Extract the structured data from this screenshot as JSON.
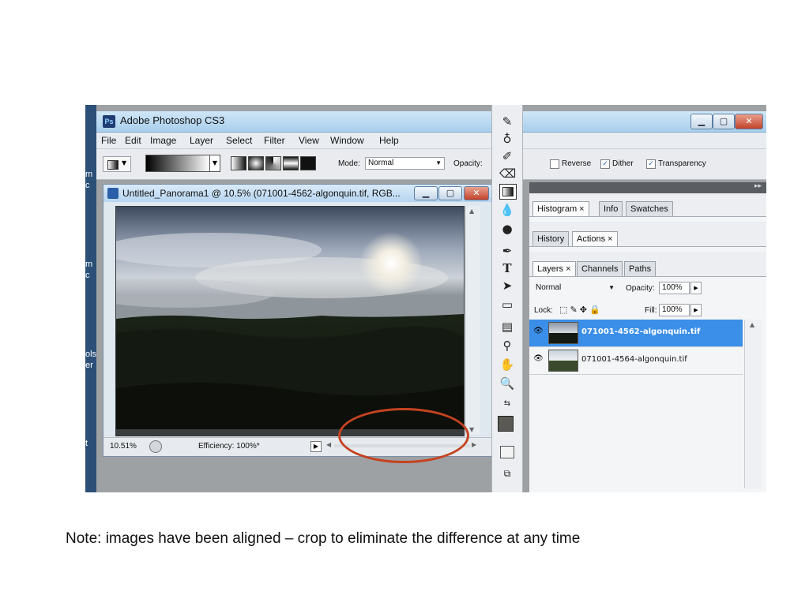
{
  "app": {
    "title": "Adobe Photoshop CS3",
    "logo": "Ps",
    "window_buttons": {
      "minimize": "▁",
      "maximize": "▢",
      "close": "✕"
    }
  },
  "desktop_strip_text": [
    "m",
    "c",
    "m",
    "c",
    "ols",
    "er",
    "t"
  ],
  "menu": [
    "File",
    "Edit",
    "Image",
    "Layer",
    "Select",
    "Filter",
    "View",
    "Window",
    "Help"
  ],
  "options_bar": {
    "mode_label": "Mode:",
    "mode_value": "Normal",
    "opacity_label": "Opacity:",
    "reverse_label": "Reverse",
    "reverse_checked": false,
    "dither_label": "Dither",
    "dither_checked": true,
    "transparency_label": "Transparency",
    "transparency_checked": true
  },
  "document": {
    "title": "Untitled_Panorama1 @ 10.5% (071001-4562-algonquin.tif, RGB...",
    "zoom": "10.51%",
    "efficiency": "Efficiency: 100%*"
  },
  "panels": {
    "group1_tabs": [
      "Histogram ×",
      "Info",
      "Swatches"
    ],
    "group2_tabs": [
      "History",
      "Actions ×"
    ],
    "group3_tabs": [
      "Layers ×",
      "Channels",
      "Paths"
    ],
    "layers": {
      "blend_mode": "Normal",
      "opacity_label": "Opacity:",
      "opacity_value": "100%",
      "lock_label": "Lock:",
      "fill_label": "Fill:",
      "fill_value": "100%",
      "items": [
        {
          "name": "071001-4562-algonquin.tif",
          "selected": true
        },
        {
          "name": "071001-4564-algonquin.tif",
          "selected": false
        }
      ]
    }
  },
  "note": "Note: images have been aligned – crop to eliminate the difference at any time",
  "colors": {
    "selection": "#3b8fe8",
    "annotation": "#c44321",
    "foreground_swatch": "#5b5954",
    "background_swatch": "#ffffff"
  },
  "icons": {
    "tools": [
      "brush-icon",
      "clone-stamp-icon",
      "history-brush-icon",
      "eraser-icon",
      "gradient-icon",
      "blur-icon",
      "dodge-icon",
      "pen-icon",
      "type-icon",
      "path-selection-icon",
      "shape-icon",
      "notes-icon",
      "eyedropper-icon",
      "hand-icon",
      "zoom-icon"
    ]
  }
}
